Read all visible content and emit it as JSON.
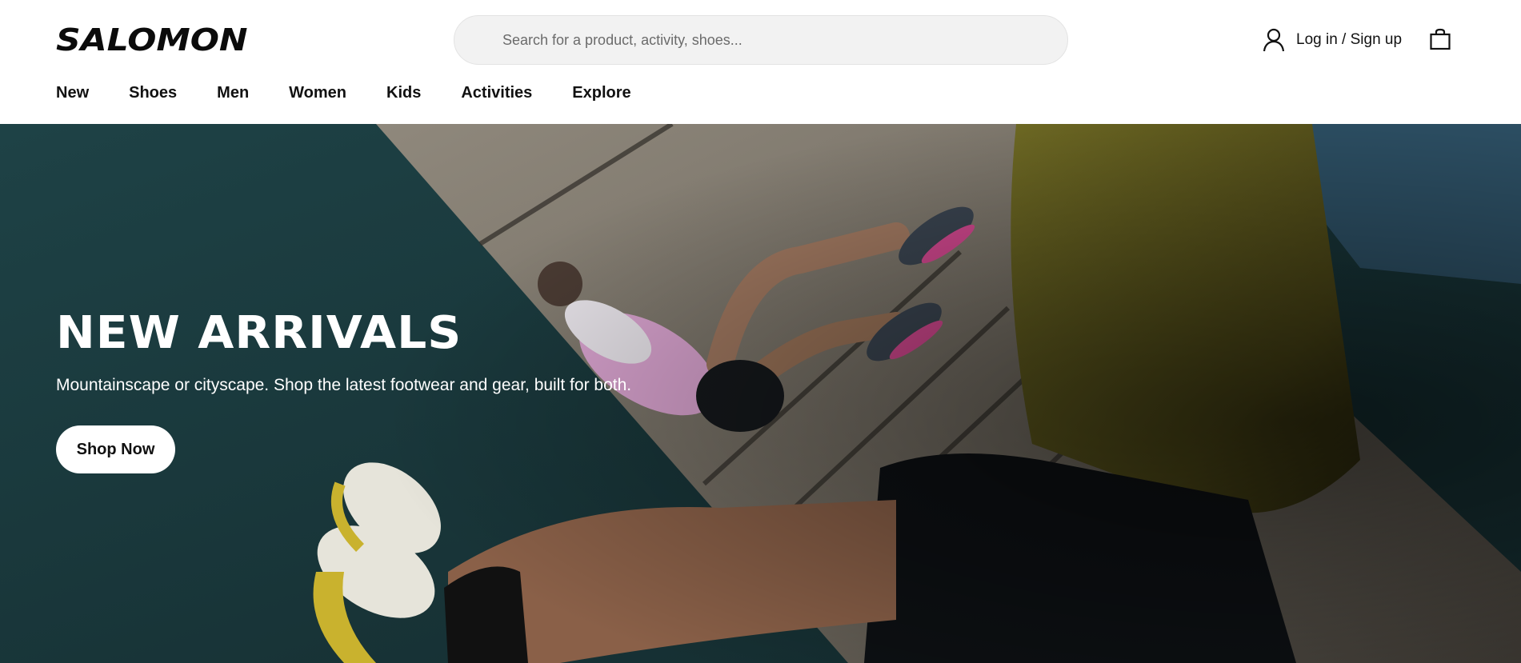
{
  "brand": {
    "logo_text": "SALOMON"
  },
  "search": {
    "placeholder": "Search for a product, activity, shoes..."
  },
  "account": {
    "login_label": "Log in / Sign up",
    "icon": "user-icon"
  },
  "cart": {
    "icon": "shopping-bag-icon"
  },
  "nav": {
    "items": [
      {
        "label": "New"
      },
      {
        "label": "Shoes"
      },
      {
        "label": "Men"
      },
      {
        "label": "Women"
      },
      {
        "label": "Kids"
      },
      {
        "label": "Activities"
      },
      {
        "label": "Explore"
      }
    ]
  },
  "hero": {
    "title": "NEW ARRIVALS",
    "subtitle": "Mountainscape or cityscape. Shop the latest footwear and gear, built for both.",
    "cta_label": "Shop Now"
  },
  "colors": {
    "text": "#111111",
    "search_bg": "#f2f2f2",
    "hero_teal": "#1d3a3f",
    "hero_concrete": "#8a8276",
    "jacket_olive": "#6b6420"
  }
}
